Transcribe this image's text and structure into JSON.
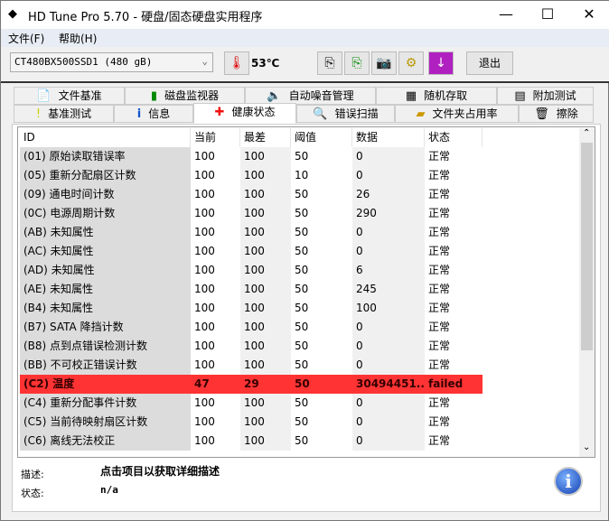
{
  "window": {
    "title": "HD Tune Pro 5.70 - 硬盘/固态硬盘实用程序",
    "minimize": "—",
    "maximize": "☐",
    "close": "✕"
  },
  "menu": [
    "文件(F)",
    "帮助(H)"
  ],
  "toolbar": {
    "drive": "CT480BX500SSD1 (480 gB)",
    "temperature": "53℃",
    "exit": "退出"
  },
  "tabs_top": [
    {
      "label": "文件基准",
      "icon": "file-benchmark-icon"
    },
    {
      "label": "磁盘监视器",
      "icon": "disk-monitor-icon"
    },
    {
      "label": "自动噪音管理",
      "icon": "speaker-icon"
    },
    {
      "label": "随机存取",
      "icon": "random-access-icon"
    },
    {
      "label": "附加测试",
      "icon": "extra-tests-icon"
    }
  ],
  "tabs_bottom": [
    {
      "label": "基准测试",
      "icon": "benchmark-icon"
    },
    {
      "label": "信息",
      "icon": "info-icon"
    },
    {
      "label": "健康状态",
      "icon": "health-cross-icon"
    },
    {
      "label": "错误扫描",
      "icon": "error-scan-icon"
    },
    {
      "label": "文件夹占用率",
      "icon": "folder-icon"
    },
    {
      "label": "擦除",
      "icon": "trash-icon"
    }
  ],
  "table": {
    "headers": [
      "ID",
      "当前",
      "最差",
      "阈值",
      "数据",
      "状态"
    ],
    "rows": [
      [
        "(01) 原始读取错误率",
        "100",
        "100",
        "50",
        "0",
        "正常"
      ],
      [
        "(05) 重新分配扇区计数",
        "100",
        "100",
        "10",
        "0",
        "正常"
      ],
      [
        "(09) 通电时间计数",
        "100",
        "100",
        "50",
        "26",
        "正常"
      ],
      [
        "(0C) 电源周期计数",
        "100",
        "100",
        "50",
        "290",
        "正常"
      ],
      [
        "(AB) 未知属性",
        "100",
        "100",
        "50",
        "0",
        "正常"
      ],
      [
        "(AC) 未知属性",
        "100",
        "100",
        "50",
        "0",
        "正常"
      ],
      [
        "(AD) 未知属性",
        "100",
        "100",
        "50",
        "6",
        "正常"
      ],
      [
        "(AE) 未知属性",
        "100",
        "100",
        "50",
        "245",
        "正常"
      ],
      [
        "(B4) 未知属性",
        "100",
        "100",
        "50",
        "100",
        "正常"
      ],
      [
        "(B7) SATA 降挡计数",
        "100",
        "100",
        "50",
        "0",
        "正常"
      ],
      [
        "(B8) 点到点错误检测计数",
        "100",
        "100",
        "50",
        "0",
        "正常"
      ],
      [
        "(BB) 不可校正错误计数",
        "100",
        "100",
        "50",
        "0",
        "正常"
      ],
      [
        "(C2) 温度",
        "47",
        "29",
        "50",
        "30494451...",
        "failed"
      ],
      [
        "(C4) 重新分配事件计数",
        "100",
        "100",
        "50",
        "0",
        "正常"
      ],
      [
        "(C5) 当前待映射扇区计数",
        "100",
        "100",
        "50",
        "0",
        "正常"
      ],
      [
        "(C6) 离线无法校正",
        "100",
        "100",
        "50",
        "0",
        "正常"
      ]
    ]
  },
  "details": {
    "desc_label": "描述:",
    "desc_value": "点击项目以获取详细描述",
    "status_label": "状态:",
    "status_value": "n/a"
  },
  "colors": {
    "failed": "#ff3333"
  }
}
